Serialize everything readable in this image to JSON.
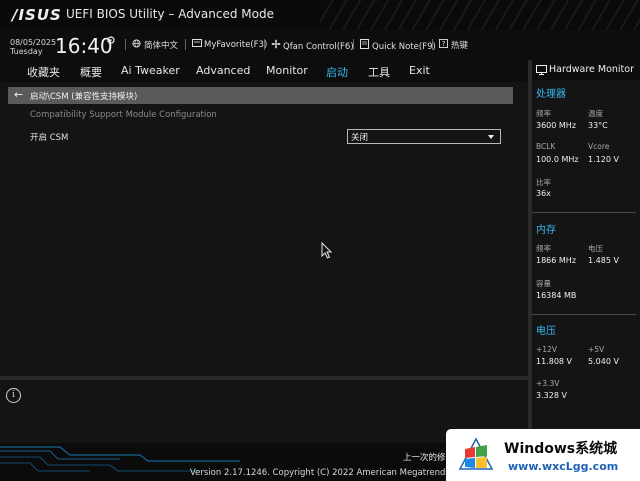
{
  "titlebar": {
    "logo": "/ISUS",
    "title": "UEFI BIOS Utility – Advanced Mode"
  },
  "infobar": {
    "date": "08/05/2025",
    "day": "Tuesday",
    "time": "16:40",
    "items": [
      {
        "label": "简体中文",
        "icon": "globe-icon"
      },
      {
        "label": "MyFavorite(F3)",
        "icon": "favorite-icon"
      },
      {
        "label": "Qfan Control(F6)",
        "icon": "fan-icon"
      },
      {
        "label": "Quick Note(F9)",
        "icon": "note-icon"
      },
      {
        "label": "热键",
        "icon": "hotkey-icon"
      }
    ]
  },
  "nav": {
    "tabs": [
      "收藏夹",
      "概要",
      "Ai Tweaker",
      "Advanced",
      "Monitor",
      "启动",
      "工具",
      "Exit"
    ],
    "active": "启动"
  },
  "main": {
    "breadcrumb": "启动\\CSM (兼容性支持模块)",
    "section_header": "Compatibility Support Module Configuration",
    "settings": [
      {
        "label": "开启 CSM",
        "value": "关闭"
      }
    ]
  },
  "hw_monitor": {
    "title": "Hardware Monitor",
    "cpu": {
      "section": "处理器",
      "freq_label": "频率",
      "freq": "3600 MHz",
      "temp_label": "温度",
      "temp": "33°C",
      "bclk_label": "BCLK",
      "bclk": "100.0 MHz",
      "vcore_label": "Vcore",
      "vcore": "1.120 V",
      "ratio_label": "比率",
      "ratio": "36x"
    },
    "memory": {
      "section": "内存",
      "freq_label": "频率",
      "freq": "1866 MHz",
      "volt_label": "电压",
      "volt": "1.485 V",
      "cap_label": "容量",
      "cap": "16384 MB"
    },
    "voltage": {
      "section": "电压",
      "v12_label": "+12V",
      "v12": "11.808 V",
      "v5_label": "+5V",
      "v5": "5.040 V",
      "v33_label": "+3.3V",
      "v33": "3.328 V"
    }
  },
  "footer": {
    "last_modified": "上一次的修",
    "version": "Version 2.17.1246. Copyright (C) 2022 American Megatrends, In"
  },
  "watermark": {
    "brand": "Windows系统城",
    "site": "www.wxcLgg.com"
  },
  "colors": {
    "accent": "#39b7f0",
    "background": "#141414",
    "breadcrumb_bar": "#5a5a5a"
  }
}
